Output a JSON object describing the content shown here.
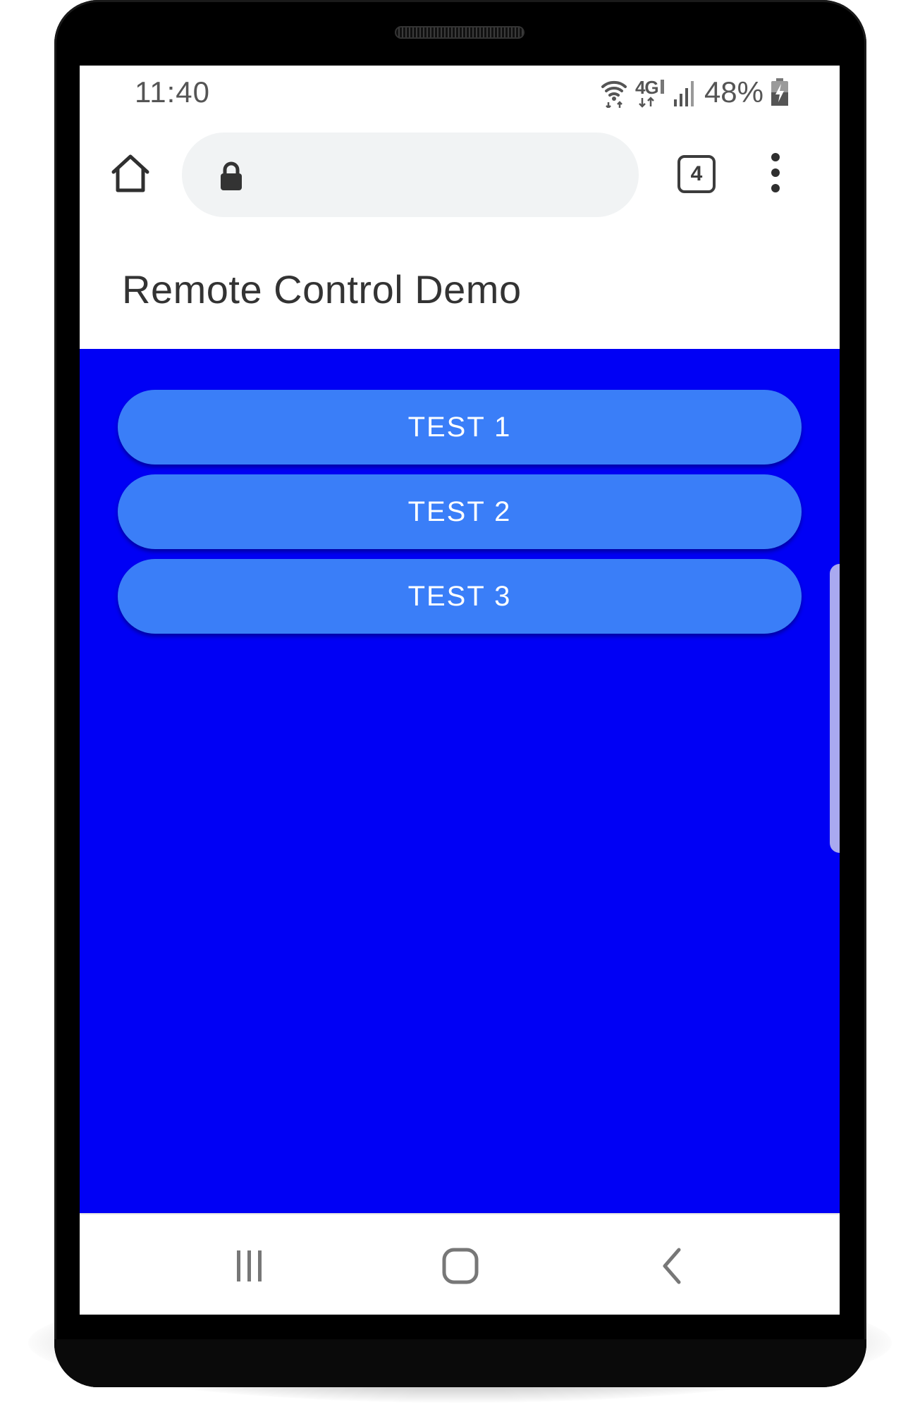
{
  "status_bar": {
    "time": "11:40",
    "network_label": "4G",
    "battery_percent": "48%",
    "icons": [
      "wifi-icon",
      "lte-icon",
      "signal-icon",
      "battery-charging-icon"
    ]
  },
  "browser": {
    "address_value": "",
    "tab_count": "4",
    "icons": [
      "home-icon",
      "lock-icon",
      "tabs-icon",
      "more-vert-icon"
    ]
  },
  "app": {
    "title": "Remote Control Demo",
    "buttons": [
      {
        "label": "TEST 1"
      },
      {
        "label": "TEST 2"
      },
      {
        "label": "TEST 3"
      }
    ],
    "colors": {
      "background": "#0000f5",
      "button": "#3a7ef8",
      "button_text": "#ffffff"
    }
  },
  "nav_bar": {
    "icons": [
      "recent-apps-icon",
      "home-nav-icon",
      "back-icon"
    ]
  }
}
